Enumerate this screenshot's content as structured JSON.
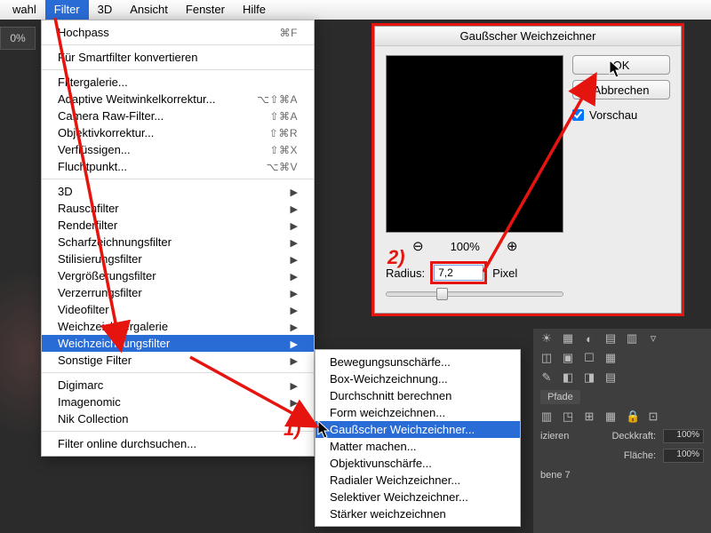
{
  "menubar": {
    "items": [
      "wahl",
      "Filter",
      "3D",
      "Ansicht",
      "Fenster",
      "Hilfe"
    ],
    "active_index": 1
  },
  "zoom_badge": "0%",
  "filter_menu": {
    "groups": [
      [
        {
          "label": "Hochpass",
          "shortcut": "⌘F"
        }
      ],
      [
        {
          "label": "Für Smartfilter konvertieren"
        }
      ],
      [
        {
          "label": "Filtergalerie..."
        },
        {
          "label": "Adaptive Weitwinkelkorrektur...",
          "shortcut": "⌥⇧⌘A"
        },
        {
          "label": "Camera Raw-Filter...",
          "shortcut": "⇧⌘A"
        },
        {
          "label": "Objektivkorrektur...",
          "shortcut": "⇧⌘R"
        },
        {
          "label": "Verflüssigen...",
          "shortcut": "⇧⌘X"
        },
        {
          "label": "Fluchtpunkt...",
          "shortcut": "⌥⌘V"
        }
      ],
      [
        {
          "label": "3D",
          "submenu": true
        },
        {
          "label": "Rauschfilter",
          "submenu": true
        },
        {
          "label": "Renderfilter",
          "submenu": true
        },
        {
          "label": "Scharfzeichnungsfilter",
          "submenu": true
        },
        {
          "label": "Stilisierungsfilter",
          "submenu": true
        },
        {
          "label": "Vergrößerungsfilter",
          "submenu": true
        },
        {
          "label": "Verzerrungsfilter",
          "submenu": true
        },
        {
          "label": "Videofilter",
          "submenu": true
        },
        {
          "label": "Weichzeichnergalerie",
          "submenu": true
        },
        {
          "label": "Weichzeichnungsfilter",
          "submenu": true,
          "selected": true
        },
        {
          "label": "Sonstige Filter",
          "submenu": true
        }
      ],
      [
        {
          "label": "Digimarc",
          "submenu": true
        },
        {
          "label": "Imagenomic",
          "submenu": true
        },
        {
          "label": "Nik Collection",
          "submenu": true
        }
      ],
      [
        {
          "label": "Filter online durchsuchen..."
        }
      ]
    ]
  },
  "blur_submenu": {
    "items": [
      "Bewegungsunschärfe...",
      "Box-Weichzeichnung...",
      "Durchschnitt berechnen",
      "Form weichzeichnen...",
      "Gaußscher Weichzeichner...",
      "Matter machen...",
      "Objektivunschärfe...",
      "Radialer Weichzeichner...",
      "Selektiver Weichzeichner...",
      "Stärker weichzeichnen"
    ],
    "selected_index": 4
  },
  "dialog": {
    "title": "Gaußscher Weichzeichner",
    "ok": "OK",
    "cancel": "Abbrechen",
    "preview_label": "Vorschau",
    "preview_checked": true,
    "zoom_percent": "100%",
    "radius_label": "Radius:",
    "radius_value": "7,2",
    "radius_unit": "Pixel"
  },
  "annotations": {
    "step1": "1)",
    "step2": "2)"
  },
  "panels": {
    "tab_paths": "Pfade",
    "mode": "izieren",
    "opacity_label": "Deckkraft:",
    "opacity_value": "100%",
    "fill_label": "Fläche:",
    "fill_value": "100%",
    "layer_name": "bene 7",
    "icons_row1": [
      "☀",
      "▦",
      "◐",
      "▤",
      "▥",
      "▿"
    ],
    "icons_row2": [
      "◫",
      "▣",
      "☐",
      "▦"
    ],
    "icons_row3": [
      "✎",
      "◧",
      "◨",
      "▤"
    ],
    "icons_row4": [
      "▥",
      "◳",
      "⊞",
      "▦",
      "🔒",
      "⊡"
    ]
  }
}
